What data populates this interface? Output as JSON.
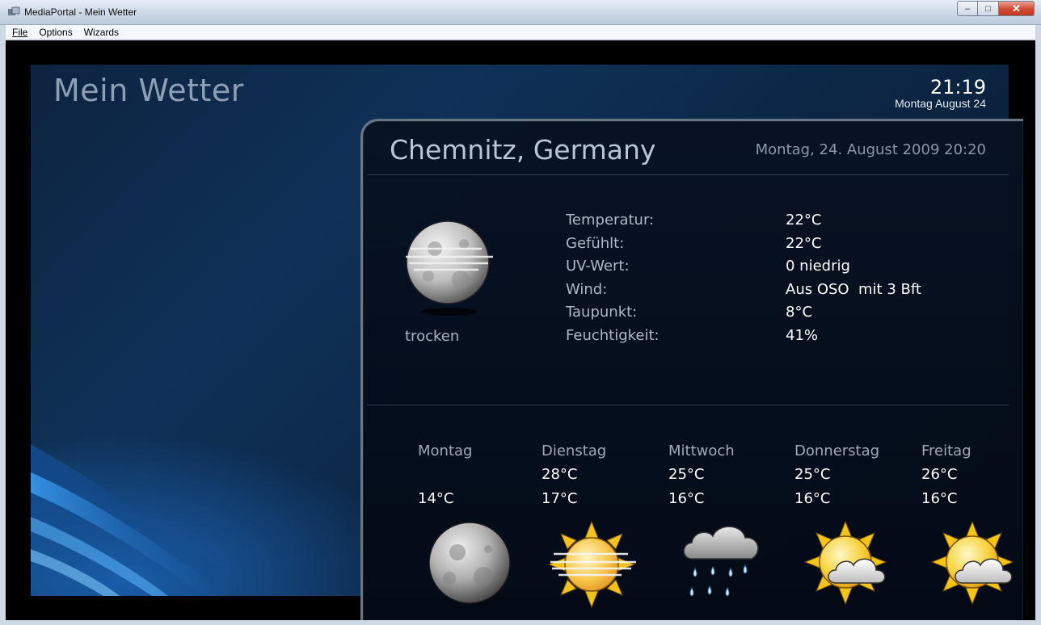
{
  "window": {
    "title": "MediaPortal - Mein Wetter"
  },
  "menu": {
    "items": [
      "File",
      "Options",
      "Wizards"
    ]
  },
  "header": {
    "title": "Mein Wetter",
    "time": "21:19",
    "date": "Montag August 24"
  },
  "location": {
    "name": "Chemnitz, Germany",
    "updated": "Montag, 24. August 2009 20:20"
  },
  "current": {
    "condition": "trocken",
    "icon": "fog-moon-icon",
    "details": [
      {
        "label": "Temperatur:",
        "value": "22°C"
      },
      {
        "label": "Gefühlt:",
        "value": "22°C"
      },
      {
        "label": "UV-Wert:",
        "value": "0 niedrig"
      },
      {
        "label": "Wind:",
        "value": "Aus OSO  mit 3 Bft"
      },
      {
        "label": "Taupunkt:",
        "value": "8°C"
      },
      {
        "label": "Feuchtigkeit:",
        "value": "41%"
      }
    ]
  },
  "forecast": [
    {
      "day": "Montag",
      "high": "",
      "low": "14°C",
      "icon": "moon-icon"
    },
    {
      "day": "Dienstag",
      "high": "28°C",
      "low": "17°C",
      "icon": "hazy-sun-icon"
    },
    {
      "day": "Mittwoch",
      "high": "25°C",
      "low": "16°C",
      "icon": "rain-cloud-icon"
    },
    {
      "day": "Donnerstag",
      "high": "25°C",
      "low": "16°C",
      "icon": "partly-cloudy-icon"
    },
    {
      "day": "Freitag",
      "high": "26°C",
      "low": "16°C",
      "icon": "partly-cloudy-icon"
    }
  ],
  "colors": {
    "accent": "#0f3157",
    "panel": "#081222",
    "title_gray": "#8d9fb4"
  }
}
